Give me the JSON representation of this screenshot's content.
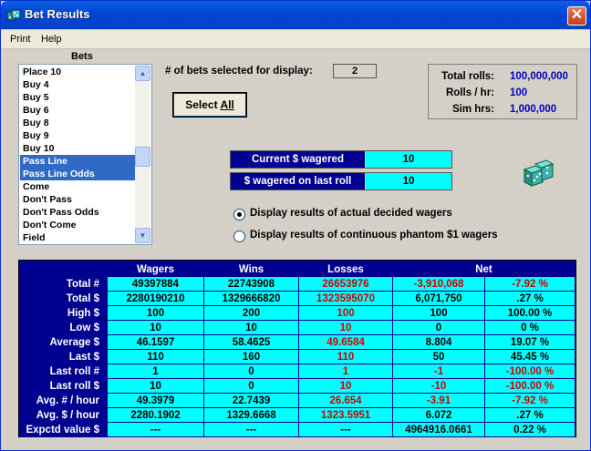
{
  "window": {
    "title": "Bet Results"
  },
  "menu": {
    "items": [
      "Print",
      "Help"
    ]
  },
  "bets": {
    "label": "Bets",
    "items": [
      {
        "label": "Place 10",
        "selected": false
      },
      {
        "label": "Buy 4",
        "selected": false
      },
      {
        "label": "Buy 5",
        "selected": false
      },
      {
        "label": "Buy 6",
        "selected": false
      },
      {
        "label": "Buy 8",
        "selected": false
      },
      {
        "label": "Buy 9",
        "selected": false
      },
      {
        "label": "Buy 10",
        "selected": false
      },
      {
        "label": "Pass Line",
        "selected": true
      },
      {
        "label": "Pass Line Odds",
        "selected": true
      },
      {
        "label": "Come",
        "selected": false
      },
      {
        "label": "Don't Pass",
        "selected": false
      },
      {
        "label": "Don't Pass Odds",
        "selected": false
      },
      {
        "label": "Don't Come",
        "selected": false
      },
      {
        "label": "Field",
        "selected": false
      }
    ]
  },
  "selection": {
    "label": "# of bets selected for display:",
    "count": "2"
  },
  "select_all": {
    "before": "Select ",
    "underlined": "All"
  },
  "stats": {
    "total_rolls_label": "Total rolls:",
    "total_rolls": "100,000,000",
    "rolls_hr_label": "Rolls / hr:",
    "rolls_hr": "100",
    "sim_hrs_label": "Sim hrs:",
    "sim_hrs": "1,000,000"
  },
  "wagers": {
    "current_label": "Current $ wagered",
    "current_value": "10",
    "last_roll_label": "$ wagered on last roll",
    "last_roll_value": "10"
  },
  "display_options": {
    "actual_label": "Display results of actual decided wagers",
    "phantom_label": "Display results of continuous phantom $1 wagers",
    "selected": "actual"
  },
  "colors": {
    "header_bg": "#000090",
    "cell_bg": "#00ffff",
    "negative": "#d00000",
    "stat_value": "#0000c0"
  },
  "results": {
    "headers": [
      "",
      "Wagers",
      "Wins",
      "Losses",
      "Net",
      ""
    ],
    "rows": [
      {
        "label": "Total #",
        "wagers": "49397884",
        "wins": "22743908",
        "losses": "26653976",
        "net": "-3,910,068",
        "pct": "-7.92 %",
        "net_neg": true,
        "pct_neg": true
      },
      {
        "label": "Total $",
        "wagers": "2280190210",
        "wins": "1329666820",
        "losses": "1323595070",
        "net": "6,071,750",
        "pct": ".27 %",
        "net_neg": false,
        "pct_neg": false
      },
      {
        "label": "High $",
        "wagers": "100",
        "wins": "200",
        "losses": "100",
        "net": "100",
        "pct": "100.00 %",
        "net_neg": false,
        "pct_neg": false
      },
      {
        "label": "Low $",
        "wagers": "10",
        "wins": "10",
        "losses": "10",
        "net": "0",
        "pct": "0 %",
        "net_neg": false,
        "pct_neg": false
      },
      {
        "label": "Average $",
        "wagers": "46.1597",
        "wins": "58.4625",
        "losses": "49.6584",
        "net": "8.804",
        "pct": "19.07 %",
        "net_neg": false,
        "pct_neg": false
      },
      {
        "label": "Last $",
        "wagers": "110",
        "wins": "160",
        "losses": "110",
        "net": "50",
        "pct": "45.45 %",
        "net_neg": false,
        "pct_neg": false
      },
      {
        "label": "Last roll #",
        "wagers": "1",
        "wins": "0",
        "losses": "1",
        "net": "-1",
        "pct": "-100.00 %",
        "net_neg": true,
        "pct_neg": true
      },
      {
        "label": "Last roll $",
        "wagers": "10",
        "wins": "0",
        "losses": "10",
        "net": "-10",
        "pct": "-100.00 %",
        "net_neg": true,
        "pct_neg": true
      },
      {
        "label": "Avg. # / hour",
        "wagers": "49.3979",
        "wins": "22.7439",
        "losses": "26.654",
        "net": "-3.91",
        "pct": "-7.92 %",
        "net_neg": true,
        "pct_neg": true
      },
      {
        "label": "Avg. $ / hour",
        "wagers": "2280.1902",
        "wins": "1329.6668",
        "losses": "1323.5951",
        "net": "6.072",
        "pct": ".27 %",
        "net_neg": false,
        "pct_neg": false
      },
      {
        "label": "Expctd value $",
        "wagers": "---",
        "wins": "---",
        "losses": "---",
        "net": "4964916.0661",
        "pct": "0.22 %",
        "net_neg": false,
        "pct_neg": false
      }
    ]
  }
}
